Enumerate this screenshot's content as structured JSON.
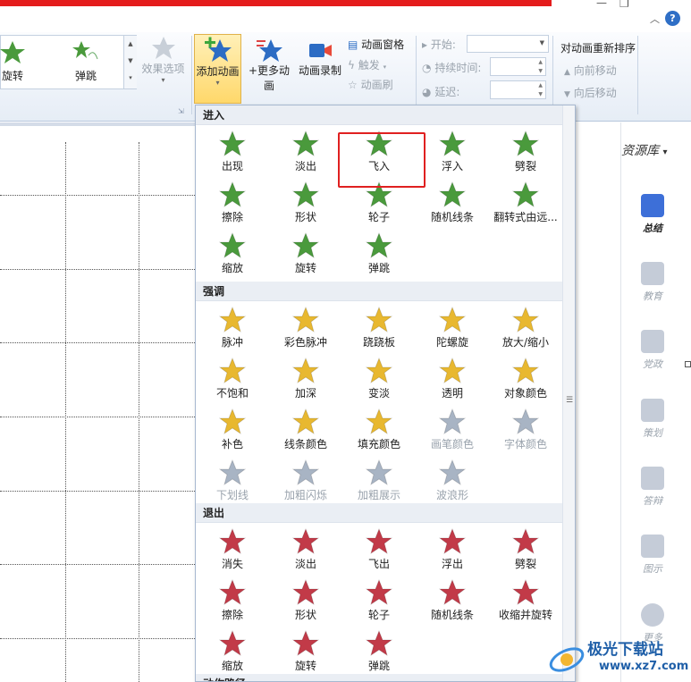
{
  "window": {
    "minimize_icon": "minimize-icon",
    "restore_icon": "restore-icon",
    "collapse_icon": "chevron-up-icon",
    "help_label": "?"
  },
  "ribbon": {
    "gallery": [
      {
        "label": "旋转"
      },
      {
        "label": "弹跳"
      }
    ],
    "effect_options": "效果选项",
    "add_animation": "添加动画",
    "more_animations": "+更多动画",
    "record_animation": "动画录制",
    "animation_pane": "动画窗格",
    "trigger": "触发",
    "animation_brush": "动画刷",
    "start_label": "开始:",
    "duration_label": "持续时间:",
    "delay_label": "延迟:",
    "reorder_title": "对动画重新排序",
    "move_earlier": "向前移动",
    "move_later": "向后移动"
  },
  "side_panel": {
    "library_label": "资源库",
    "items": [
      {
        "label": "总结"
      },
      {
        "label": "教育"
      },
      {
        "label": "党政"
      },
      {
        "label": "策划"
      },
      {
        "label": "答辩"
      },
      {
        "label": "图示"
      },
      {
        "label": "更多"
      }
    ]
  },
  "panel": {
    "sections": [
      {
        "title": "进入",
        "items": [
          {
            "label": "出现",
            "disabled": false
          },
          {
            "label": "淡出",
            "disabled": false
          },
          {
            "label": "飞入",
            "disabled": false
          },
          {
            "label": "浮入",
            "disabled": false
          },
          {
            "label": "劈裂",
            "disabled": false
          },
          {
            "label": "擦除",
            "disabled": false
          },
          {
            "label": "形状",
            "disabled": false
          },
          {
            "label": "轮子",
            "disabled": false
          },
          {
            "label": "随机线条",
            "disabled": false
          },
          {
            "label": "翻转式由远...",
            "disabled": false
          },
          {
            "label": "缩放",
            "disabled": false
          },
          {
            "label": "旋转",
            "disabled": false
          },
          {
            "label": "弹跳",
            "disabled": false
          }
        ]
      },
      {
        "title": "强调",
        "items": [
          {
            "label": "脉冲",
            "disabled": false
          },
          {
            "label": "彩色脉冲",
            "disabled": false
          },
          {
            "label": "跷跷板",
            "disabled": false
          },
          {
            "label": "陀螺旋",
            "disabled": false
          },
          {
            "label": "放大/缩小",
            "disabled": false
          },
          {
            "label": "不饱和",
            "disabled": false
          },
          {
            "label": "加深",
            "disabled": false
          },
          {
            "label": "变淡",
            "disabled": false
          },
          {
            "label": "透明",
            "disabled": false
          },
          {
            "label": "对象颜色",
            "disabled": false
          },
          {
            "label": "补色",
            "disabled": false
          },
          {
            "label": "线条颜色",
            "disabled": false
          },
          {
            "label": "填充颜色",
            "disabled": false
          },
          {
            "label": "画笔颜色",
            "disabled": true
          },
          {
            "label": "字体颜色",
            "disabled": true
          },
          {
            "label": "下划线",
            "disabled": true
          },
          {
            "label": "加粗闪烁",
            "disabled": true
          },
          {
            "label": "加粗展示",
            "disabled": true
          },
          {
            "label": "波浪形",
            "disabled": true
          }
        ]
      },
      {
        "title": "退出",
        "items": [
          {
            "label": "消失",
            "disabled": false
          },
          {
            "label": "淡出",
            "disabled": false
          },
          {
            "label": "飞出",
            "disabled": false
          },
          {
            "label": "浮出",
            "disabled": false
          },
          {
            "label": "劈裂",
            "disabled": false
          },
          {
            "label": "擦除",
            "disabled": false
          },
          {
            "label": "形状",
            "disabled": false
          },
          {
            "label": "轮子",
            "disabled": false
          },
          {
            "label": "随机线条",
            "disabled": false
          },
          {
            "label": "收缩并旋转",
            "disabled": false
          },
          {
            "label": "缩放",
            "disabled": false
          },
          {
            "label": "旋转",
            "disabled": false
          },
          {
            "label": "弹跳",
            "disabled": false
          }
        ]
      },
      {
        "title": "动作路径",
        "items": []
      }
    ]
  },
  "watermark": {
    "text": "极光下载站",
    "url": "www.xz7.com"
  },
  "colors": {
    "entrance": "#4a9a3c",
    "emphasis": "#e8b830",
    "exit": "#c23a48",
    "disabled": "#a8b4c4",
    "highlight": "#e02020"
  }
}
